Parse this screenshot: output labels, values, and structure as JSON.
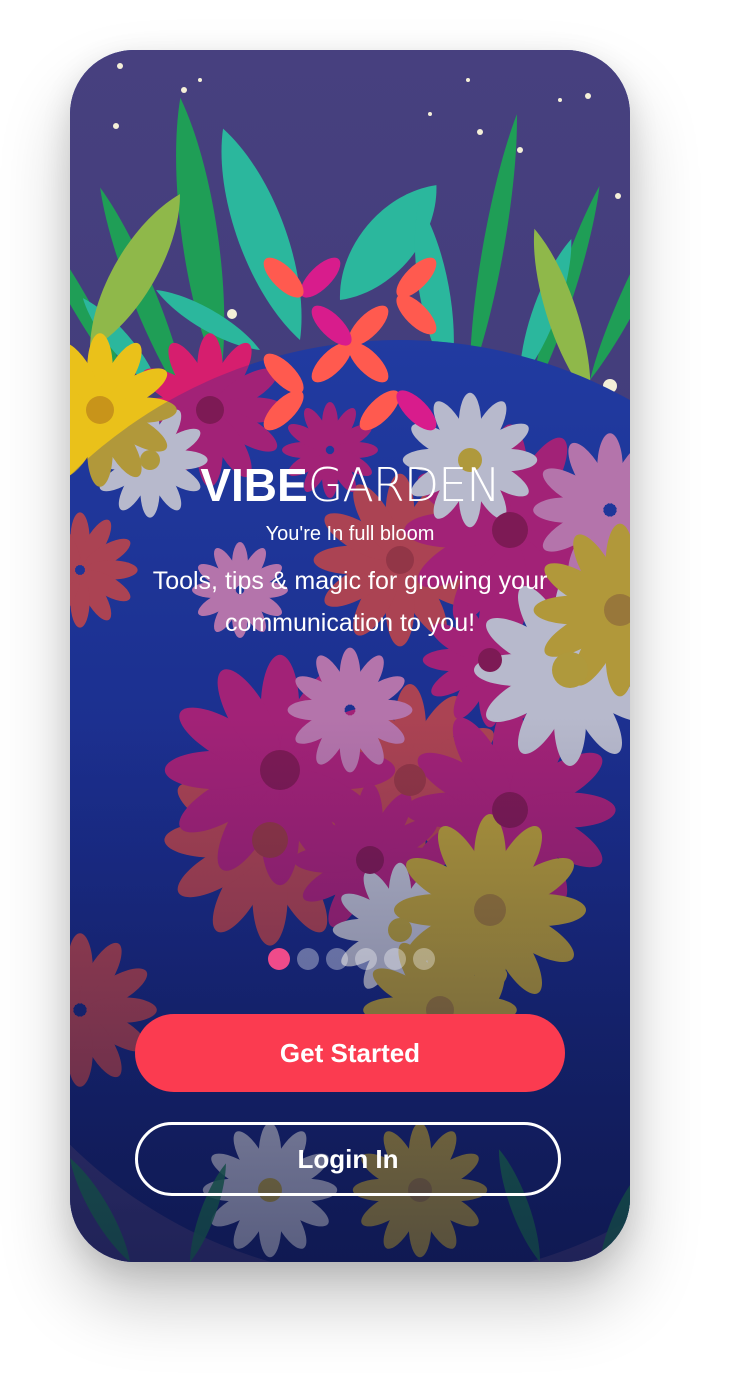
{
  "brand": {
    "name_bold": "VIBE",
    "name_light": "GARDEN",
    "tagline": "You're In full bloom",
    "description": "Tools, tips & magic for growing your communication to you!"
  },
  "carousel": {
    "total_pages": 6,
    "active_index": 0
  },
  "actions": {
    "primary_label": "Get Started",
    "secondary_label": "Login In"
  },
  "colors": {
    "accent": "#fb3b50",
    "dot_active": "#ef4b8a",
    "sky": "#3e3a7a",
    "globe": "#1f35a0",
    "text": "#ffffff"
  },
  "icons": {
    "logo": "petal-flower-logo"
  }
}
